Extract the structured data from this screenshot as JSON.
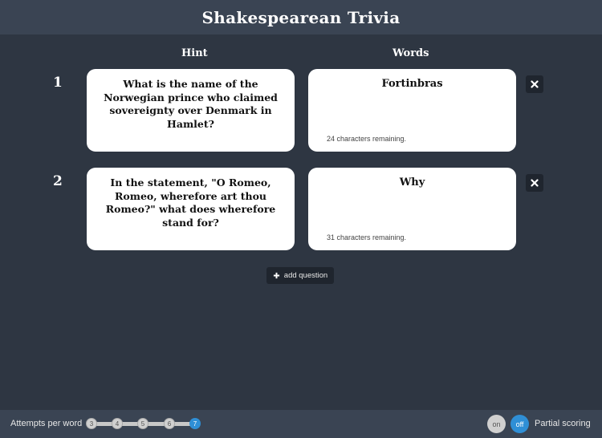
{
  "header": {
    "title": "Shakespearean Trivia"
  },
  "columns": {
    "hint": "Hint",
    "words": "Words"
  },
  "questions": [
    {
      "number": "1",
      "hint": "What is the name of the Norwegian prince who claimed sovereignty over Denmark in Hamlet?",
      "word": "Fortinbras",
      "remaining": "24 characters remaining."
    },
    {
      "number": "2",
      "hint": "In the statement, \"O Romeo, Romeo, wherefore art thou Romeo?\" what does wherefore stand for?",
      "word": "Why",
      "remaining": "31 characters remaining."
    }
  ],
  "add_question_label": "add question",
  "footer": {
    "attempts_label": "Attempts per word",
    "attempt_options": [
      "3",
      "4",
      "5",
      "6",
      "7"
    ],
    "selected_attempts": "7",
    "partial_scoring": {
      "on_label": "on",
      "off_label": "off",
      "selected": "off",
      "label": "Partial scoring"
    }
  },
  "colors": {
    "background": "#2e3642",
    "header": "#3a4453",
    "accent": "#2f8fd6",
    "button": "#1f252e"
  }
}
